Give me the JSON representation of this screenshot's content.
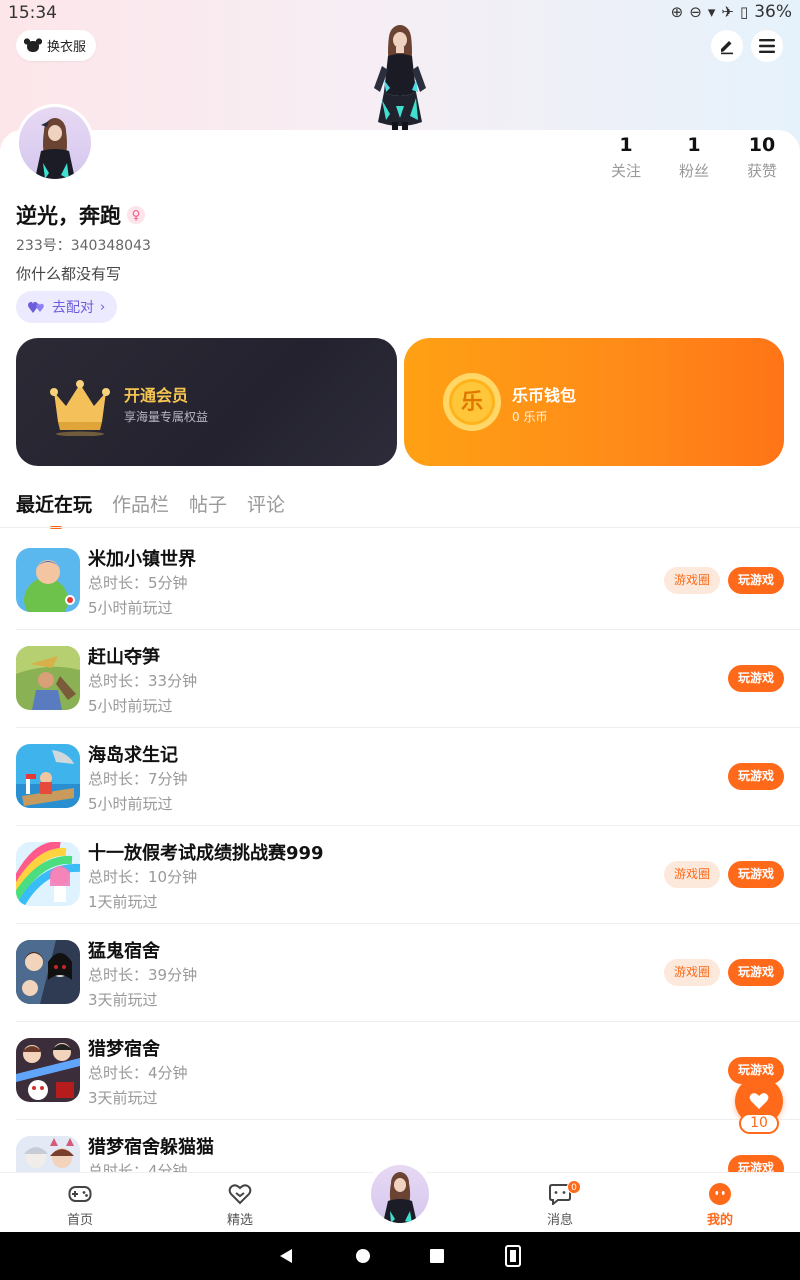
{
  "status_bar": {
    "time": "15:34",
    "battery": "36%"
  },
  "header": {
    "outfit_label": "换衣服",
    "edit_icon": "edit-icon",
    "menu_icon": "menu-icon"
  },
  "profile": {
    "username": "逆光，奔跑",
    "gender": "female",
    "uid": "233号：340348043",
    "bio": "你什么都没有写",
    "match_label": "去配对",
    "stats": [
      {
        "value": "1",
        "label": "关注"
      },
      {
        "value": "1",
        "label": "粉丝"
      },
      {
        "value": "10",
        "label": "获赞"
      }
    ]
  },
  "vip_card": {
    "title": "开通会员",
    "subtitle": "享海量专属权益"
  },
  "wallet_card": {
    "title": "乐币钱包",
    "subtitle": "0 乐币",
    "coin_glyph": "乐"
  },
  "tabs": [
    {
      "label": "最近在玩",
      "active": true
    },
    {
      "label": "作品栏",
      "active": false
    },
    {
      "label": "帖子",
      "active": false
    },
    {
      "label": "评论",
      "active": false
    }
  ],
  "games": [
    {
      "name": "米加小镇世界",
      "duration": "总时长：5分钟",
      "last_played": "5小时前玩过",
      "has_circle": true
    },
    {
      "name": "赶山夺笋",
      "duration": "总时长：33分钟",
      "last_played": "5小时前玩过",
      "has_circle": false
    },
    {
      "name": "海岛求生记",
      "duration": "总时长：7分钟",
      "last_played": "5小时前玩过",
      "has_circle": false
    },
    {
      "name": "十一放假考试成绩挑战赛999",
      "duration": "总时长：10分钟",
      "last_played": "1天前玩过",
      "has_circle": true
    },
    {
      "name": "猛鬼宿舍",
      "duration": "总时长：39分钟",
      "last_played": "3天前玩过",
      "has_circle": true
    },
    {
      "name": "猎梦宿舍",
      "duration": "总时长：4分钟",
      "last_played": "3天前玩过",
      "has_circle": false
    },
    {
      "name": "猎梦宿舍躲猫猫",
      "duration": "总时长：4分钟",
      "last_played": "",
      "has_circle": false
    }
  ],
  "game_buttons": {
    "circle_label": "游戏圈",
    "play_label": "玩游戏"
  },
  "favorite": {
    "count": "10"
  },
  "bottom_nav": [
    {
      "label": "首页",
      "icon": "gamepad-icon"
    },
    {
      "label": "精选",
      "icon": "heart-icon"
    },
    {
      "label": "",
      "icon": "avatar-center"
    },
    {
      "label": "消息",
      "icon": "chat-icon",
      "badge": "0"
    },
    {
      "label": "我的",
      "icon": "profile-icon",
      "active": true
    }
  ],
  "colors": {
    "accent": "#ff6a1a",
    "vip_gold": "#f5c451",
    "match_purple": "#6c5ddb"
  }
}
